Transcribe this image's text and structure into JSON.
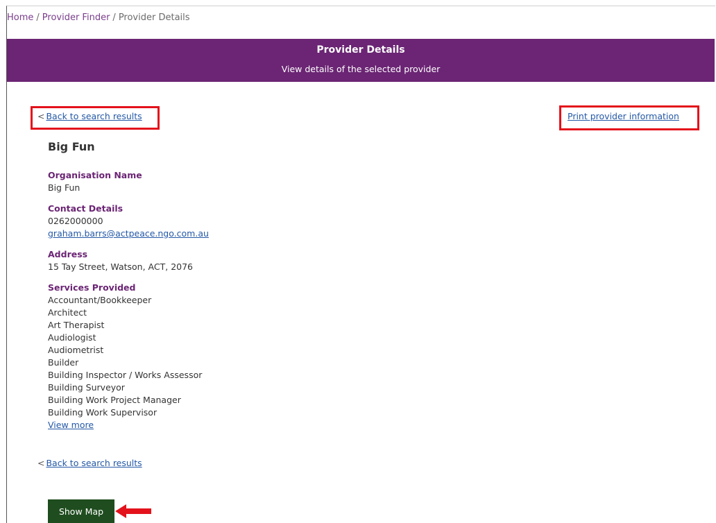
{
  "breadcrumb": {
    "home": "Home",
    "finder": "Provider Finder",
    "current": "Provider Details",
    "separator": "/"
  },
  "banner": {
    "title": "Provider Details",
    "subtitle": "View details of the selected provider",
    "color": "#6b2574"
  },
  "nav": {
    "back_prefix": "<",
    "back_label": "Back to search results",
    "print_label": "Print provider information"
  },
  "provider": {
    "name": "Big Fun",
    "org_label": "Organisation Name",
    "org_value": "Big Fun",
    "contact_label": "Contact Details",
    "phone": "0262000000",
    "email": "graham.barrs@actpeace.ngo.com.au",
    "address_label": "Address",
    "address": "15 Tay Street, Watson, ACT, 2076",
    "services_label": "Services Provided",
    "services": [
      "Accountant/Bookkeeper",
      "Architect",
      "Art Therapist",
      "Audiologist",
      "Audiometrist",
      "Builder",
      "Building Inspector / Works Assessor",
      "Building Surveyor",
      "Building Work Project Manager",
      "Building Work Supervisor"
    ],
    "view_more": "View more"
  },
  "map": {
    "button_label": "Show Map",
    "button_color": "#1f4d1f"
  },
  "annotations": {
    "highlight_color": "#e3121b",
    "arrow_icon": "left-arrow-icon"
  }
}
